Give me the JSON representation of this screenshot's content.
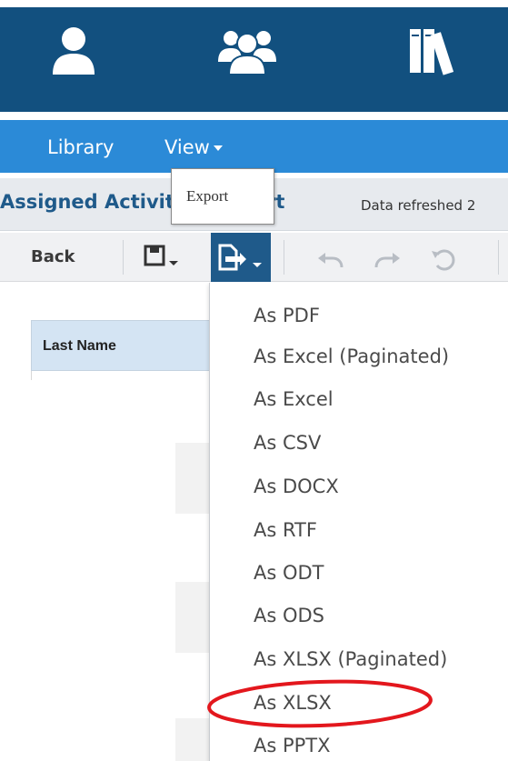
{
  "app": {
    "top_icons": [
      "user-icon",
      "users-group-icon",
      "library-books-icon"
    ]
  },
  "menu": {
    "library": "Library",
    "view": "View"
  },
  "report": {
    "title": "Assigned Activities Report",
    "refreshed": "Data refreshed 2"
  },
  "toolbar": {
    "back": "Back",
    "tooltip": "Export",
    "icons": [
      "save-icon",
      "export-icon",
      "undo-icon",
      "redo-icon",
      "reset-icon"
    ]
  },
  "table": {
    "columns": [
      "Last Name"
    ]
  },
  "export_menu": {
    "items": [
      "As PDF",
      "As Excel (Paginated)",
      "As Excel",
      "As CSV",
      "As DOCX",
      "As RTF",
      "As ODT",
      "As ODS",
      "As XLSX (Paginated)",
      "As XLSX",
      "As PPTX"
    ],
    "highlighted": "As XLSX",
    "highlight_color": "#e3171d"
  },
  "colors": {
    "header_band": "#12507f",
    "menu_bar": "#2b8ad7",
    "title_text": "#1f5a8a",
    "export_button": "#1f5a8a",
    "table_header": "#d4e4f3"
  }
}
